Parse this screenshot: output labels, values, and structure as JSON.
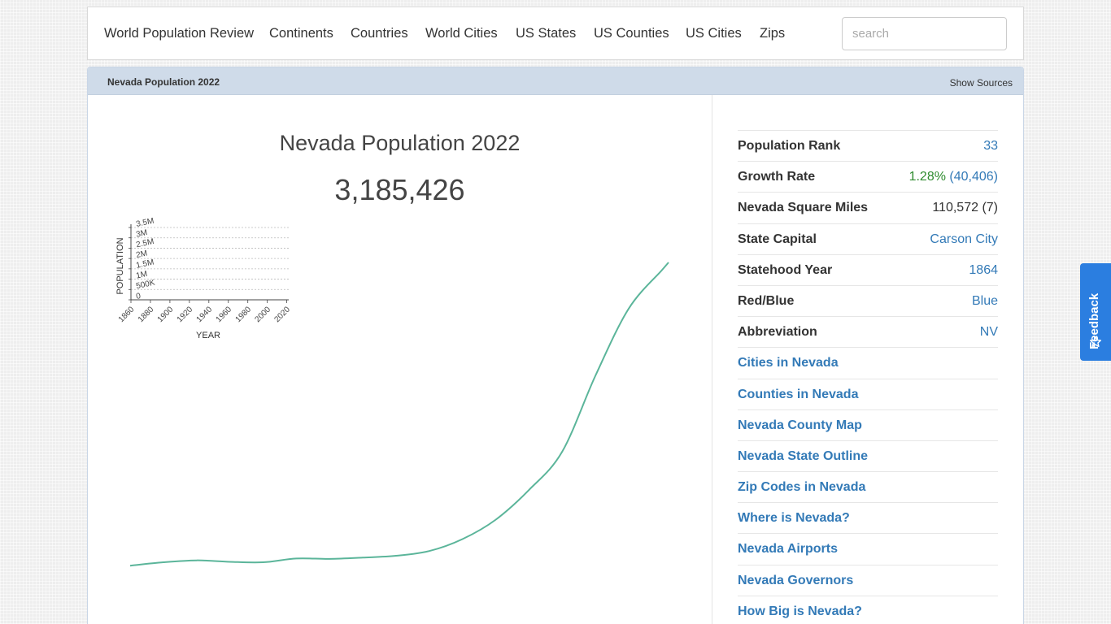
{
  "nav": {
    "items": [
      "World Population Review",
      "Continents",
      "Countries",
      "World Cities",
      "US States",
      "US Counties",
      "US Cities",
      "Zips"
    ],
    "search_placeholder": "search"
  },
  "panel": {
    "heading": "Nevada Population 2022",
    "show_sources": "Show Sources"
  },
  "main": {
    "title": "Nevada Population 2022",
    "population": "3,185,426"
  },
  "stats": {
    "rows": [
      {
        "label": "Population Rank",
        "value": "33"
      },
      {
        "label": "Growth Rate",
        "value_pct": "1.28%",
        "value_abs": "(40,406)"
      },
      {
        "label": "Nevada Square Miles",
        "value": "110,572 (7)"
      },
      {
        "label": "State Capital",
        "value": "Carson City"
      },
      {
        "label": "Statehood Year",
        "value": "1864"
      },
      {
        "label": "Red/Blue",
        "value": "Blue"
      },
      {
        "label": "Abbreviation",
        "value": "NV"
      }
    ],
    "links": [
      "Cities in Nevada",
      "Counties in Nevada",
      "Nevada County Map",
      "Nevada State Outline",
      "Zip Codes in Nevada",
      "Where is Nevada?",
      "Nevada Airports",
      "Nevada Governors",
      "How Big is Nevada?"
    ]
  },
  "feedback": {
    "label": "Feedback",
    "icon": "star-sparkle-icon"
  },
  "colors": {
    "line": "#5bb59a",
    "link": "#337ab7",
    "growth": "#2e8b2e",
    "feedback": "#2b7ee0",
    "heading_bg": "#cfdbe9"
  },
  "chart_data": {
    "type": "line",
    "xlabel": "YEAR",
    "ylabel": "POPULATION",
    "x_ticks": [
      "1860",
      "1880",
      "1900",
      "1920",
      "1940",
      "1960",
      "1980",
      "2000",
      "2020"
    ],
    "y_ticks": [
      "0",
      "500K",
      "1M",
      "1.5M",
      "2M",
      "2.5M",
      "3M",
      "3.5M"
    ],
    "xlim": [
      1860,
      2022
    ],
    "ylim": [
      0,
      3500000
    ],
    "grid": true,
    "series": [
      {
        "x": [
          1860,
          1870,
          1880,
          1890,
          1900,
          1910,
          1920,
          1930,
          1940,
          1950,
          1960,
          1970,
          1980,
          1990,
          2000,
          2010,
          2020,
          2022
        ],
        "y": [
          6857,
          42491,
          62266,
          47355,
          42335,
          81875,
          77407,
          91058,
          110247,
          160083,
          285278,
          488738,
          800493,
          1201833,
          1998257,
          2700551,
          3104614,
          3185426
        ]
      }
    ]
  }
}
